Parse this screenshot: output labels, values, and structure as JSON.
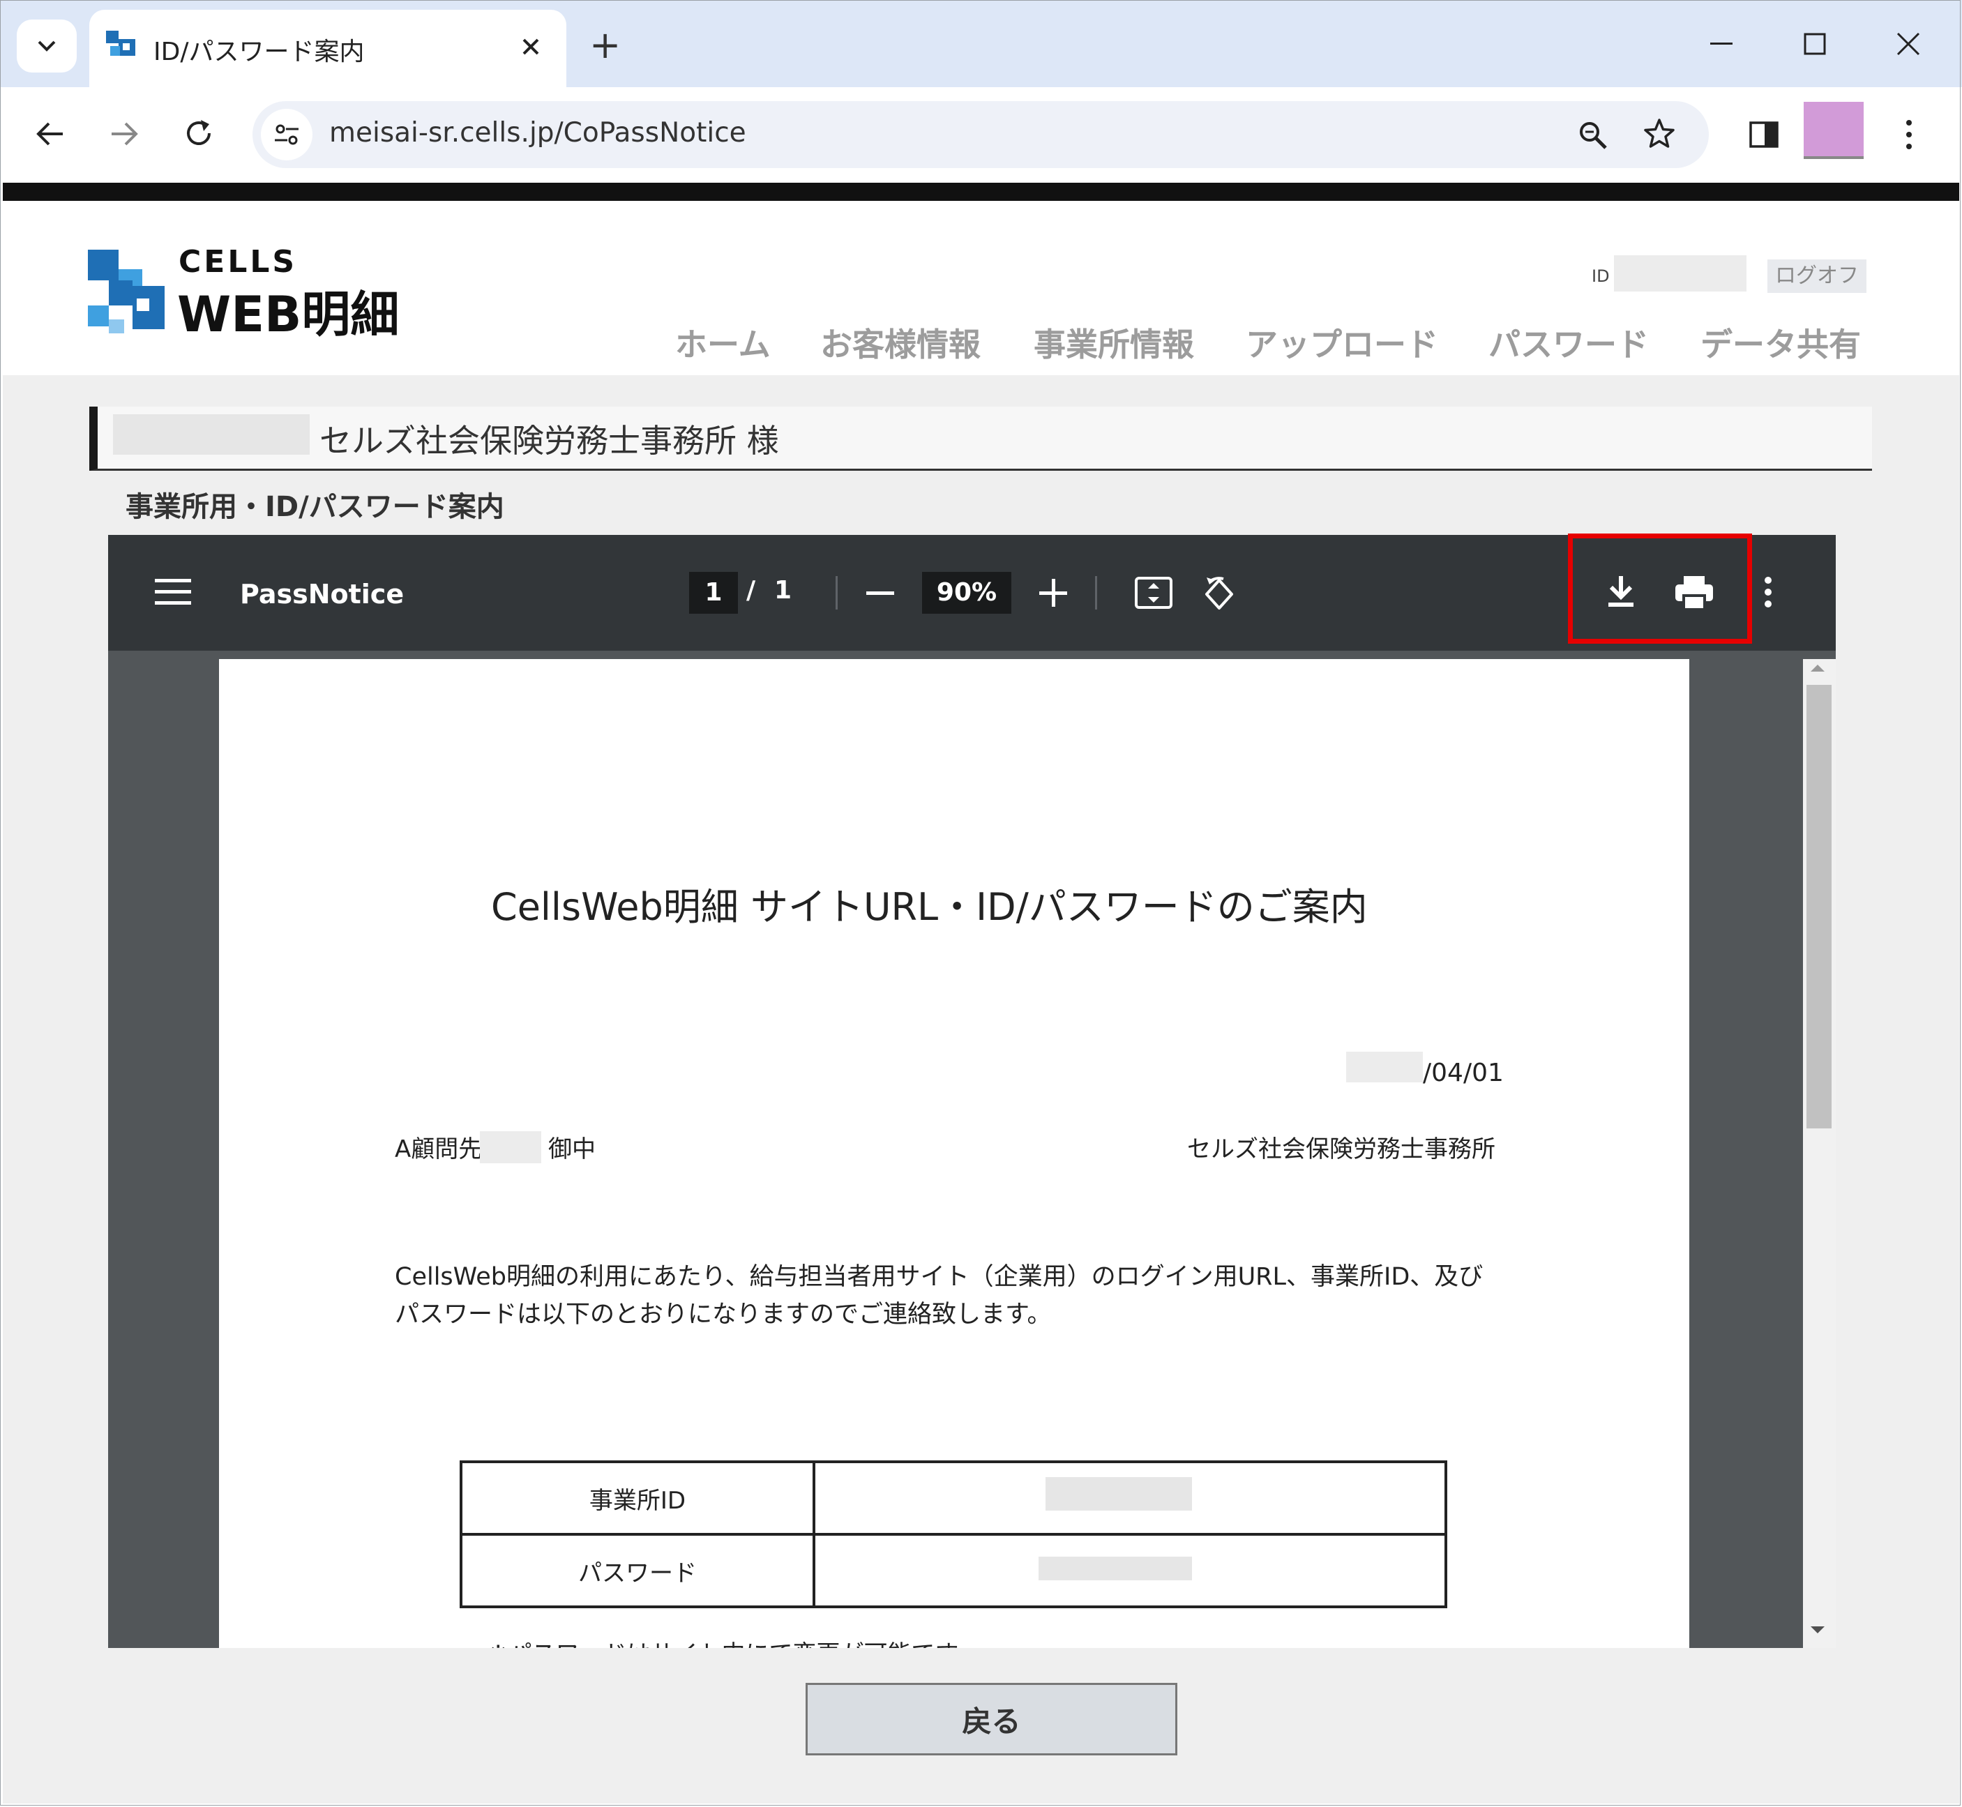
{
  "browser": {
    "tab_title": "ID/パスワード案内",
    "new_tab": "+",
    "url": "meisai-sr.cells.jp/CoPassNotice",
    "profile_color": "#d29bd8"
  },
  "site": {
    "logo_top": "CELLS",
    "logo_bottom": "WEB明細",
    "id_label": "ID",
    "logoff": "ログオフ",
    "nav": [
      "ホーム",
      "お客様情報",
      "事業所情報",
      "アップロード",
      "パスワード",
      "データ共有"
    ]
  },
  "page": {
    "client_name": "セルズ社会保険労務士事務所 様",
    "section_title": "事業所用・ID/パスワード案内",
    "back_button": "戻る"
  },
  "pdf_viewer": {
    "file_name": "PassNotice",
    "current_page": "1",
    "page_separator": "/",
    "total_pages": "1",
    "zoom": "90%",
    "highlight_color": "#e60000"
  },
  "pdf_document": {
    "title": "CellsWeb明細 サイトURL・ID/パスワードのご案内",
    "date": "/04/01",
    "recipient_prefix": "A顧問先",
    "recipient_suffix": "御中",
    "sender": "セルズ社会保険労務士事務所",
    "body_line1": "CellsWeb明細の利用にあたり、給与担当者用サイト（企業用）のログイン用URL、事業所ID、及び",
    "body_line2": "パスワードは以下のとおりになりますのでご連絡致します。",
    "table": [
      {
        "label": "事業所ID"
      },
      {
        "label": "パスワード"
      }
    ],
    "footnote": "※パスワードはサイト内にて変更が可能です。"
  }
}
